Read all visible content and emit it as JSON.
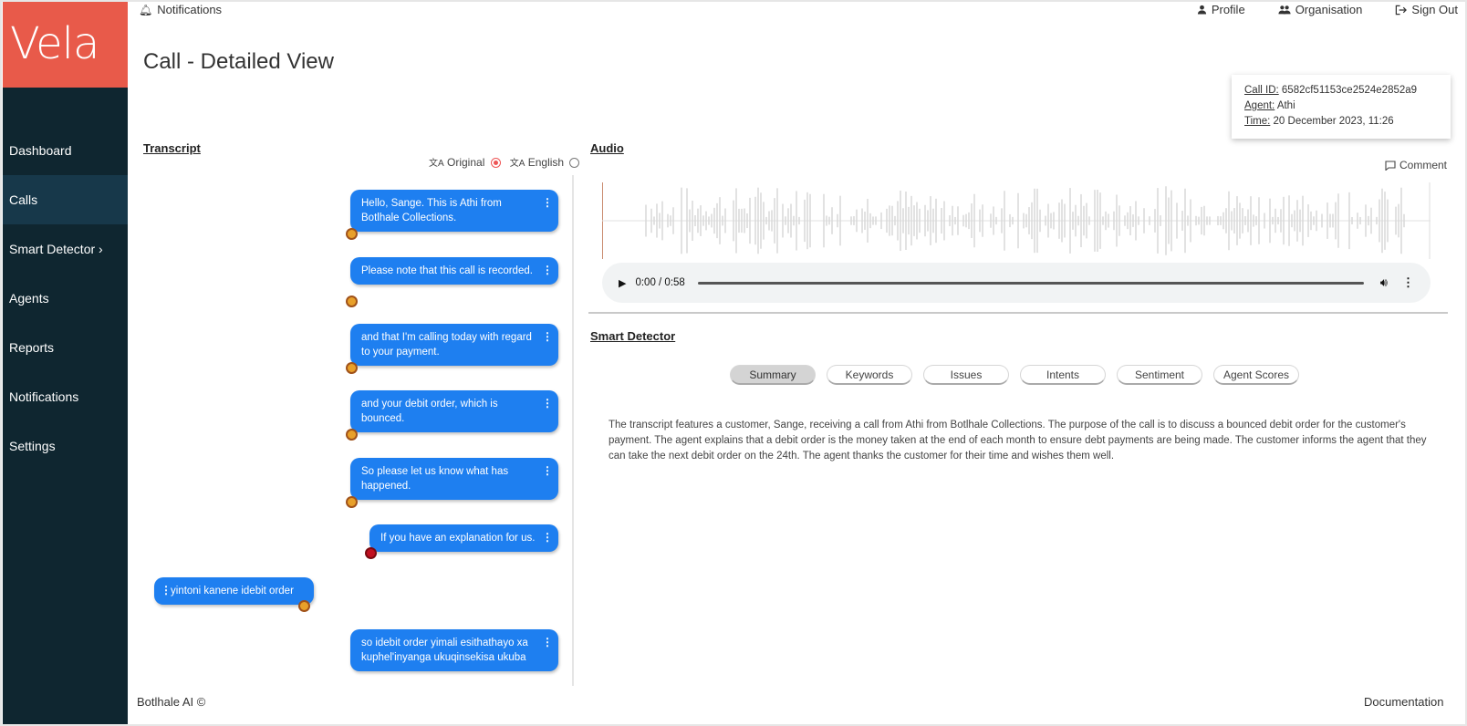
{
  "app": {
    "logo": "Vela"
  },
  "topbar": {
    "notifications": "Notifications",
    "profile": "Profile",
    "organisation": "Organisation",
    "sign_out": "Sign Out"
  },
  "page": {
    "title": "Call - Detailed View"
  },
  "sidebar": {
    "items": [
      {
        "label": "Dashboard"
      },
      {
        "label": "Calls"
      },
      {
        "label": "Smart Detector ›"
      },
      {
        "label": "Agents"
      },
      {
        "label": "Reports"
      },
      {
        "label": "Notifications"
      },
      {
        "label": "Settings"
      }
    ]
  },
  "call_info": {
    "call_id_label": "Call ID:",
    "call_id": "6582cf51153ce2524e2852a9",
    "agent_label": "Agent:",
    "agent": "Athi",
    "time_label": "Time:",
    "time": "20 December 2023, 11:26"
  },
  "transcript": {
    "title": "Transcript",
    "lang_original": "Original",
    "lang_english": "English",
    "selected_language": "Original",
    "messages": [
      {
        "speaker": "agent",
        "text": "Hello, Sange. This is Athi from Botlhale Collections."
      },
      {
        "speaker": "agent",
        "text": "Please note that this call is recorded."
      },
      {
        "speaker": "agent",
        "text": "and that I'm calling today with regard to your payment."
      },
      {
        "speaker": "agent",
        "text": "and your debit order, which is bounced."
      },
      {
        "speaker": "agent",
        "text": "So please let us know what has happened."
      },
      {
        "speaker": "agent",
        "text": "If you have an explanation for us."
      },
      {
        "speaker": "customer",
        "text": "yintoni kanene idebit order"
      },
      {
        "speaker": "agent",
        "text": "so idebit order yimali esithathayo xa kuphel'inyanga ukuqinsekisa ukuba"
      }
    ]
  },
  "audio": {
    "title": "Audio",
    "comment": "Comment",
    "time": "0:00 / 0:58",
    "progress": 0
  },
  "smart_detector": {
    "title": "Smart Detector",
    "tabs": [
      "Summary",
      "Keywords",
      "Issues",
      "Intents",
      "Sentiment",
      "Agent Scores"
    ],
    "active_tab": "Summary",
    "summary": "The transcript features a customer, Sange, receiving a call from Athi from Botlhale Collections. The purpose of the call is to discuss a bounced debit order for the customer's payment. The agent explains that a debit order is the money taken at the end of each month to ensure debt payments are being made. The customer informs the agent that they can take the next debit order on the 24th. The agent thanks the customer for their time and wishes them well."
  },
  "footer": {
    "left": "Botlhale AI ©",
    "right": "Documentation"
  },
  "colors": {
    "sidebar": "#0f2630",
    "sidebar_active": "#17384a",
    "logo_bg": "#e85a4a",
    "bubble": "#1e7ff0",
    "avatar_agent": "#e8a02a",
    "avatar_highlight": "#c01020"
  }
}
